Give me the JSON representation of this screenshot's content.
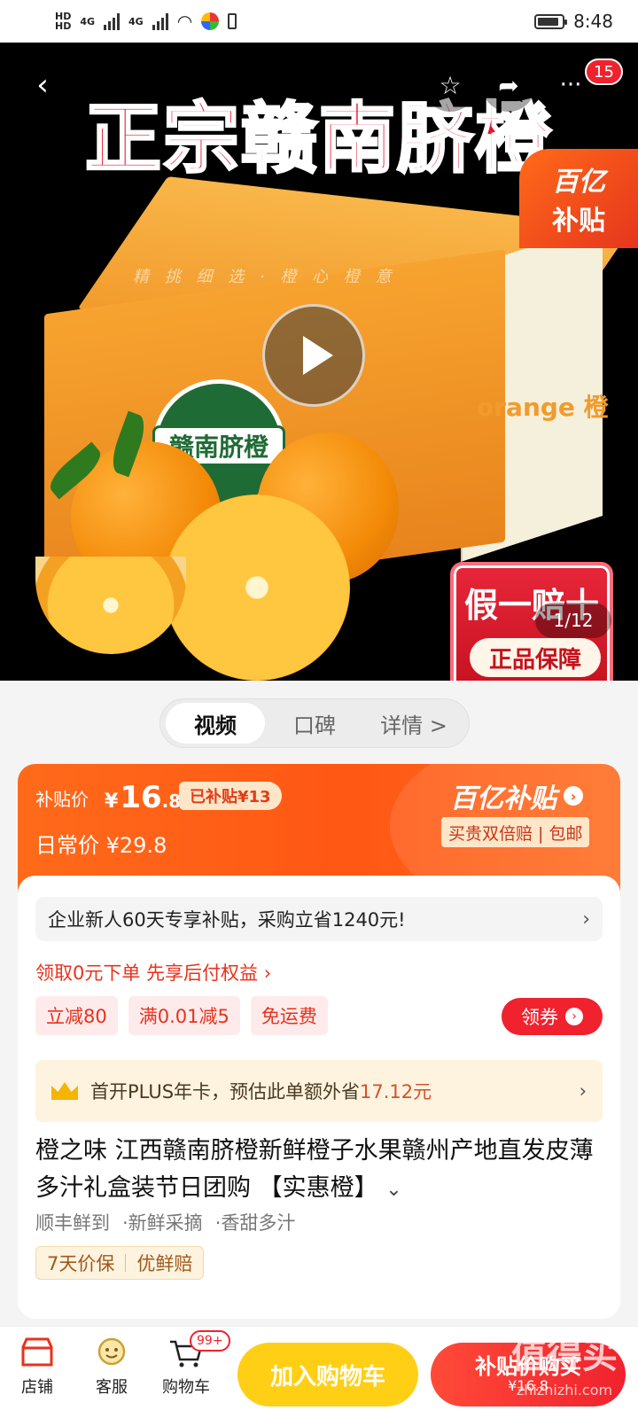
{
  "status_bar": {
    "net1": "HD",
    "net2": "HD",
    "sig1": "4G",
    "sig2": "4G",
    "time": "8:48",
    "battery_level": 0.9
  },
  "hero": {
    "title": "正宗赣南脐橙",
    "box_brand": "赣南脐橙",
    "box_side": "orange 橙",
    "subsidy_badge_line1": "百亿",
    "subsidy_badge_line2": "补贴",
    "guarantee_main": "假一赔十",
    "guarantee_sub": "正品保障",
    "image_counter": "1/12",
    "cart_count": "15"
  },
  "tabs": [
    {
      "label": "视频",
      "active": true
    },
    {
      "label": "口碑",
      "active": false
    },
    {
      "label": "详情 >",
      "active": false
    }
  ],
  "price": {
    "subsidy_label": "补贴价",
    "currency": "¥",
    "price_int": "16",
    "price_dec": ".8",
    "subsidized": "已补贴¥13",
    "regular": "日常价 ¥29.8",
    "brand": "百亿补贴",
    "tags": "买贵双倍赔 | 包邮"
  },
  "info": {
    "promo": "企业新人60天专享补贴，采购立省1240元!",
    "promo_chevron": "›",
    "credit": "领取0元下单 先享后付权益 ›",
    "coupons": [
      "立减80",
      "满0.01减5",
      "免运费"
    ],
    "coupon_button": "领券",
    "plus_text_a": "首开PLUS年卡，预估此单额外省",
    "plus_text_b": "17.12元",
    "plus_chevron": "›",
    "title": "橙之味 江西赣南脐橙新鲜橙子水果赣州产地直发皮薄多汁礼盒装节日团购 【实惠橙】",
    "title_more": "⌄",
    "features": [
      "顺丰鲜到",
      "·新鲜采摘",
      "·香甜多汁"
    ],
    "guar_tags": [
      "7天价保",
      "优鲜赔"
    ]
  },
  "bottom": {
    "store": "店铺",
    "service": "客服",
    "cart": "购物车",
    "cart_badge": "99+",
    "add_cart": "加入购物车",
    "buy_line1": "补贴价购买",
    "buy_line2": "¥16.8",
    "watermark": "值得买",
    "watermark_url": "zhizhizhi.com"
  }
}
